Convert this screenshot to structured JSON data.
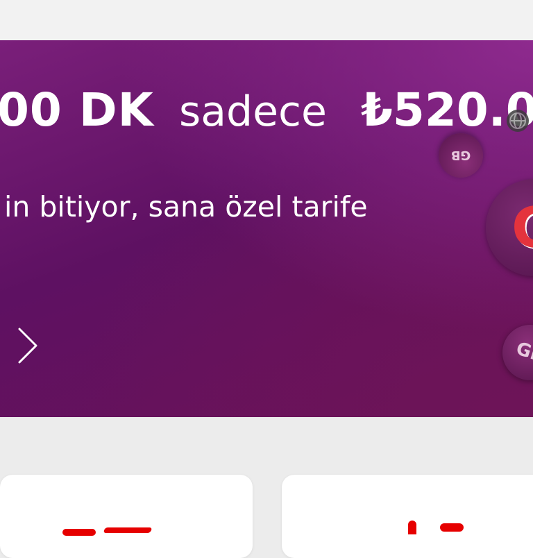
{
  "banner": {
    "minutes_text": "00 DK",
    "sadece_text": "sadece",
    "price_text": "₺520.0",
    "subtitle": "in bitiyor, sana özel tarife",
    "accent_color": "#e60000",
    "background_color": "#6a1466"
  },
  "badges": {
    "gb_small_top": "GB",
    "gb_large": "G",
    "gb_small_bottom": "GB"
  },
  "icons": {
    "arrow": "chevron-right-icon"
  }
}
